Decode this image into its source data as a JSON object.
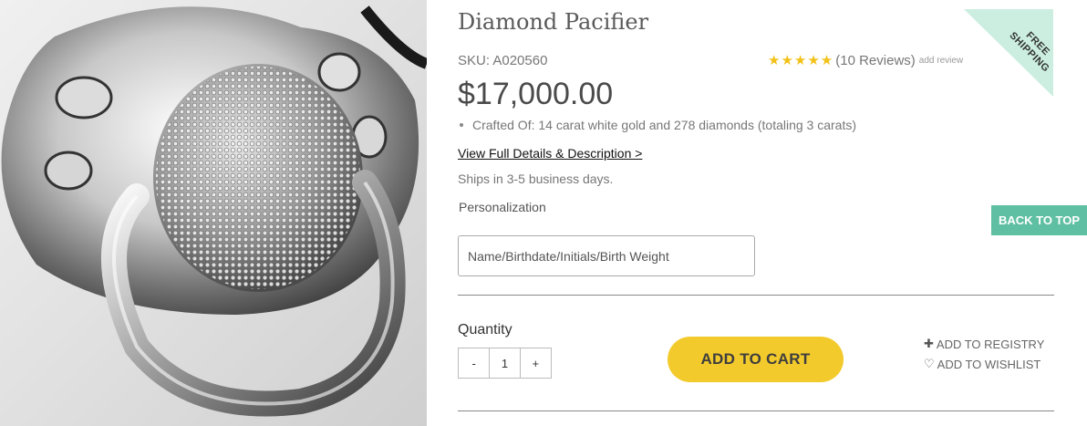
{
  "product": {
    "title": "Diamond Pacifier",
    "sku": "SKU: A020560",
    "price": "$17,000.00",
    "rating": {
      "stars": "★★★★★",
      "value": 5,
      "reviews_text": "(10 Reviews)",
      "add_review": "add review"
    },
    "features": [
      "Crafted Of: 14 carat white gold and 278 diamonds (totaling 3 carats)"
    ],
    "details_link": "View Full Details & Description >",
    "shipping_note": "Ships in 3-5 business days."
  },
  "badge": {
    "line1": "FREE",
    "line2": "SHIPPING"
  },
  "personalization": {
    "label": "Personalization",
    "placeholder": "Name/Birthdate/Initials/Birth Weight"
  },
  "quantity": {
    "label": "Quantity",
    "minus": "-",
    "value": "1",
    "plus": "+"
  },
  "actions": {
    "add_to_cart": "ADD TO CART",
    "add_to_registry": "ADD TO REGISTRY",
    "add_to_wishlist": "ADD TO WISHLIST",
    "back_to_top": "BACK TO TOP"
  },
  "icons": {
    "plus": "plus-icon",
    "heart": "heart-outline-icon",
    "star": "star-icon"
  },
  "colors": {
    "accent_yellow": "#f3ca2c",
    "star": "#f2c118",
    "teal": "#5fbfa2",
    "badge_mint": "#cbeee1"
  }
}
